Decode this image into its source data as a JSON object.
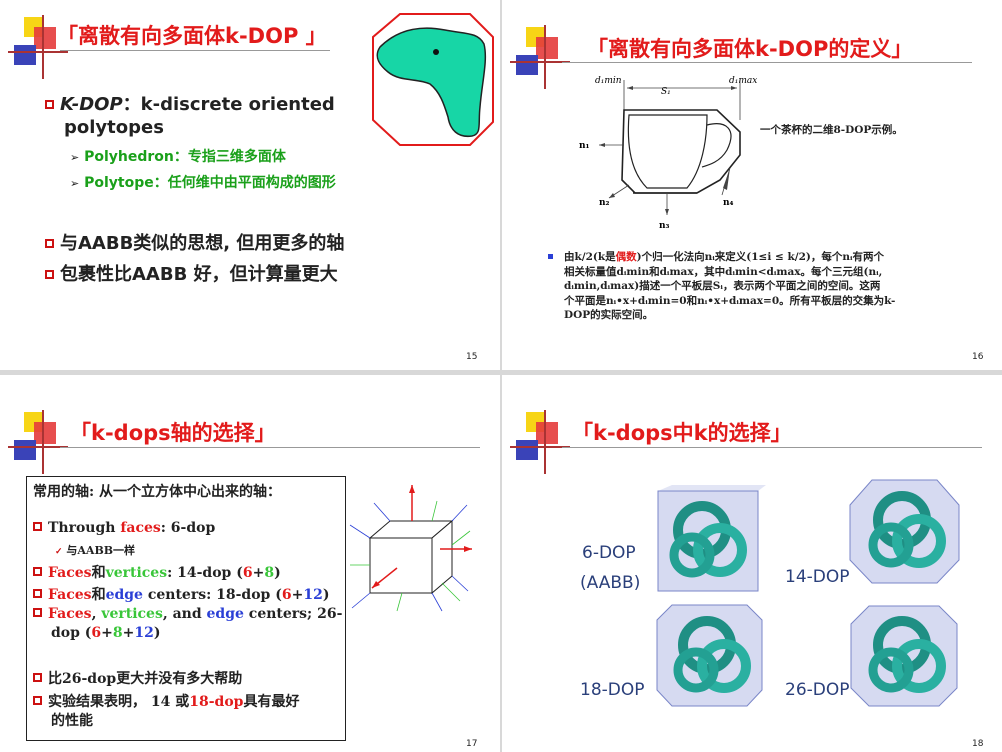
{
  "slides": [
    {
      "title": "「离散有向多面体k-DOP 」",
      "page": "15",
      "bullet1_a": "K-DOP",
      "bullet1_b": "：k-discrete oriented",
      "bullet1_c": "polytopes",
      "sub1": "Polyhedron：专指三维多面体",
      "sub2": "Polytope：任何维中由平面构成的图形",
      "bullet2": "与AABB类似的思想, 但用更多的轴",
      "bullet3": "包裹性比AABB 好，但计算量更大"
    },
    {
      "title": "「离散有向多面体k-DOP的定义」",
      "page": "16",
      "caption": "一个茶杯的二维8-DOP示例。",
      "labels": {
        "dmin": "d₁min",
        "dmax": "d₁max",
        "s1": "S₁",
        "n1": "n₁",
        "n2": "n₂",
        "n3": "n₃",
        "n4": "n₄"
      },
      "p1a": "由k/2(k是",
      "p1b": "偶数",
      "p1c": ")个归一化法向nᵢ来定义(1≤i ≤ k/2)，每个nᵢ有两个",
      "p2": "相关标量值dᵢmin和dᵢmax，其中dᵢmin<dᵢmax。每个三元组(nᵢ,",
      "p3": "dᵢmin,dᵢmax)描述一个平板层Sᵢ，表示两个平面之间的空间。这两",
      "p4": "个平面是nᵢ•x+dᵢmin=0和nᵢ•x+dᵢmax=0。所有平板层的交集为k-",
      "p5": "DOP的实际空间。"
    },
    {
      "title": "「k-dops轴的选择」",
      "page": "17",
      "head": "常用的轴: 从一个立方体中心出来的轴：",
      "l1a": "Through ",
      "l1b": "faces",
      "l1c": ": 6-dop",
      "l1sub": "与AABB一样",
      "l2a": "Faces",
      "l2b": "和",
      "l2c": "vertices",
      "l2d": ": 14-dop (",
      "l2e": "6",
      "l2f": "+",
      "l2g": "8",
      "l2h": ")",
      "l3a": "Faces",
      "l3b": "和",
      "l3c": "edge",
      "l3d": " centers: 18-dop (",
      "l3e": "6",
      "l3f": "+",
      "l3g": "12",
      "l3h": ")",
      "l4a": "Faces",
      "l4b": ", ",
      "l4c": "vertices",
      "l4d": ", and ",
      "l4e": "edge",
      "l4f": " centers; 26-",
      "l4g": "dop (",
      "l4h": "6",
      "l4i": "+",
      "l4j": "8",
      "l4k": "+",
      "l4l": "12",
      "l4m": ")",
      "l5": "比26-dop更大并没有多大帮助",
      "l6a": "实验结果表明， 14 或",
      "l6b": "18-dop",
      "l6c": "具有最好",
      "l6d": "的性能"
    },
    {
      "title": "「k-dops中k的选择」",
      "page": "18",
      "lab6": "6-DOP",
      "lab6b": "(AABB)",
      "lab14": "14-DOP",
      "lab18": "18-DOP",
      "lab26": "26-DOP"
    }
  ],
  "colors": {
    "title": "#e21b1b",
    "sub_green": "#1aa01a",
    "bullet": "#c11111",
    "teal": "#2aa596",
    "shape_fill": "#17d6a6"
  }
}
